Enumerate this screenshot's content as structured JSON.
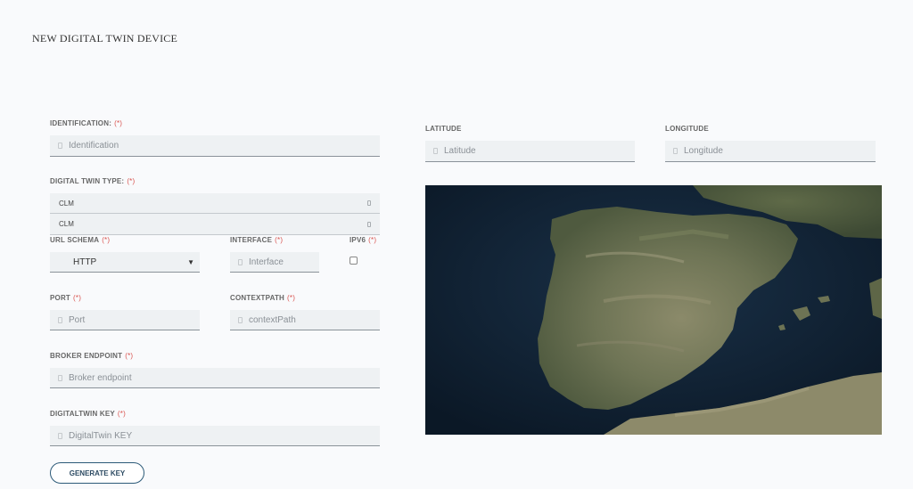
{
  "page": {
    "title": "NEW DIGITAL TWIN DEVICE"
  },
  "required_mark": "(*)",
  "form": {
    "identification": {
      "label": "IDENTIFICATION:",
      "placeholder": "Identification"
    },
    "digital_twin_type": {
      "label": "DIGITAL TWIN TYPE:",
      "options": [
        "CLM",
        "CLM"
      ]
    },
    "url_schema": {
      "label": "URL SCHEMA",
      "value": "HTTP"
    },
    "interface": {
      "label": "INTERFACE",
      "placeholder": "Interface"
    },
    "ipv6": {
      "label": "IPV6",
      "checked": false
    },
    "port": {
      "label": "PORT",
      "placeholder": "Port"
    },
    "contextpath": {
      "label": "CONTEXTPATH",
      "placeholder": "contextPath"
    },
    "broker_endpoint": {
      "label": "BROKER ENDPOINT",
      "placeholder": "Broker endpoint"
    },
    "digitaltwin_key": {
      "label": "DIGITALTWIN KEY",
      "placeholder": "DigitalTwin KEY"
    },
    "generate_key_label": "GENERATE KEY"
  },
  "location": {
    "latitude": {
      "label": "LATITUDE",
      "placeholder": "Latitude"
    },
    "longitude": {
      "label": "LONGITUDE",
      "placeholder": "Longitude"
    },
    "map": {
      "style": "satellite",
      "region": "Iberian Peninsula"
    }
  },
  "colors": {
    "required": "#d9534f",
    "field_bg": "#eef1f3",
    "button_border": "#2c5a78",
    "sea": "#0e1d2c"
  }
}
